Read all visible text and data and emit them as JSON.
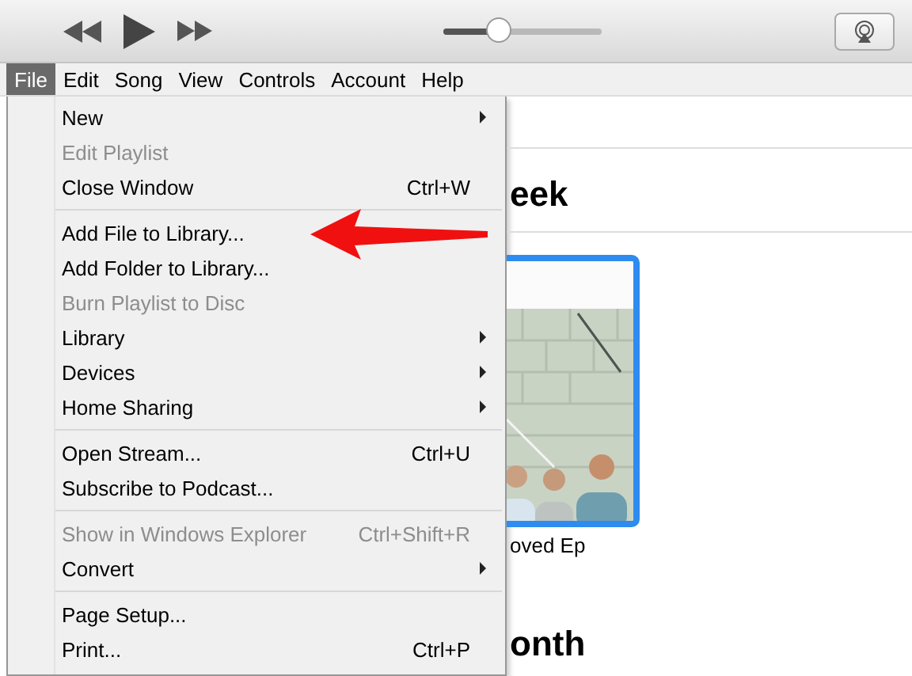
{
  "player": {
    "volume": {
      "level": 0.35
    }
  },
  "menu_bar": [
    {
      "label": "File",
      "selected": true
    },
    {
      "label": "Edit",
      "selected": false
    },
    {
      "label": "Song",
      "selected": false
    },
    {
      "label": "View",
      "selected": false
    },
    {
      "label": "Controls",
      "selected": false
    },
    {
      "label": "Account",
      "selected": false
    },
    {
      "label": "Help",
      "selected": false
    }
  ],
  "file_menu": {
    "groups": [
      {
        "items": [
          {
            "label": "New",
            "submenu": true,
            "disabled": false
          },
          {
            "label": "Edit Playlist",
            "submenu": false,
            "disabled": true
          },
          {
            "label": "Close Window",
            "shortcut": "Ctrl+W",
            "submenu": false,
            "disabled": false
          }
        ]
      },
      {
        "items": [
          {
            "label": "Add File to Library...",
            "submenu": false,
            "disabled": false
          },
          {
            "label": "Add Folder to Library...",
            "submenu": false,
            "disabled": false
          },
          {
            "label": "Burn Playlist to Disc",
            "submenu": false,
            "disabled": true
          },
          {
            "label": "Library",
            "submenu": true,
            "disabled": false
          },
          {
            "label": "Devices",
            "submenu": true,
            "disabled": false
          },
          {
            "label": "Home Sharing",
            "submenu": true,
            "disabled": false
          }
        ]
      },
      {
        "items": [
          {
            "label": "Open Stream...",
            "shortcut": "Ctrl+U",
            "submenu": false,
            "disabled": false
          },
          {
            "label": "Subscribe to Podcast...",
            "submenu": false,
            "disabled": false
          }
        ]
      },
      {
        "items": [
          {
            "label": "Show in Windows Explorer",
            "shortcut": "Ctrl+Shift+R",
            "submenu": false,
            "disabled": true
          },
          {
            "label": "Convert",
            "submenu": true,
            "disabled": false
          }
        ]
      },
      {
        "items": [
          {
            "label": "Page Setup...",
            "submenu": false,
            "disabled": false
          },
          {
            "label": "Print...",
            "shortcut": "Ctrl+P",
            "submenu": false,
            "disabled": false
          }
        ]
      }
    ]
  },
  "content": {
    "section_1_title": "eek",
    "album": {
      "kind": "picture",
      "title": "oved Ep"
    },
    "section_2_title": "onth"
  }
}
